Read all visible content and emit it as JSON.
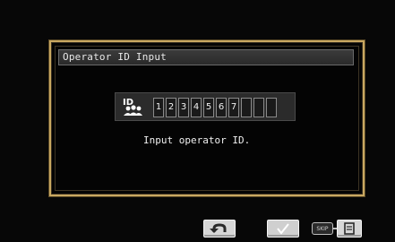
{
  "dialog": {
    "title": "Operator ID Input",
    "prompt": "Input operator ID."
  },
  "id_field": {
    "icon_label": "ID",
    "slots": [
      "1",
      "2",
      "3",
      "4",
      "5",
      "6",
      "7",
      "",
      "",
      ""
    ]
  },
  "buttons": {
    "back_icon": "return-arrow-icon",
    "confirm_icon": "checkmark-icon",
    "skip_label": "SKIP",
    "skip_icon": "document-icon"
  },
  "colors": {
    "frame": "#c9a861",
    "background": "#070707"
  }
}
